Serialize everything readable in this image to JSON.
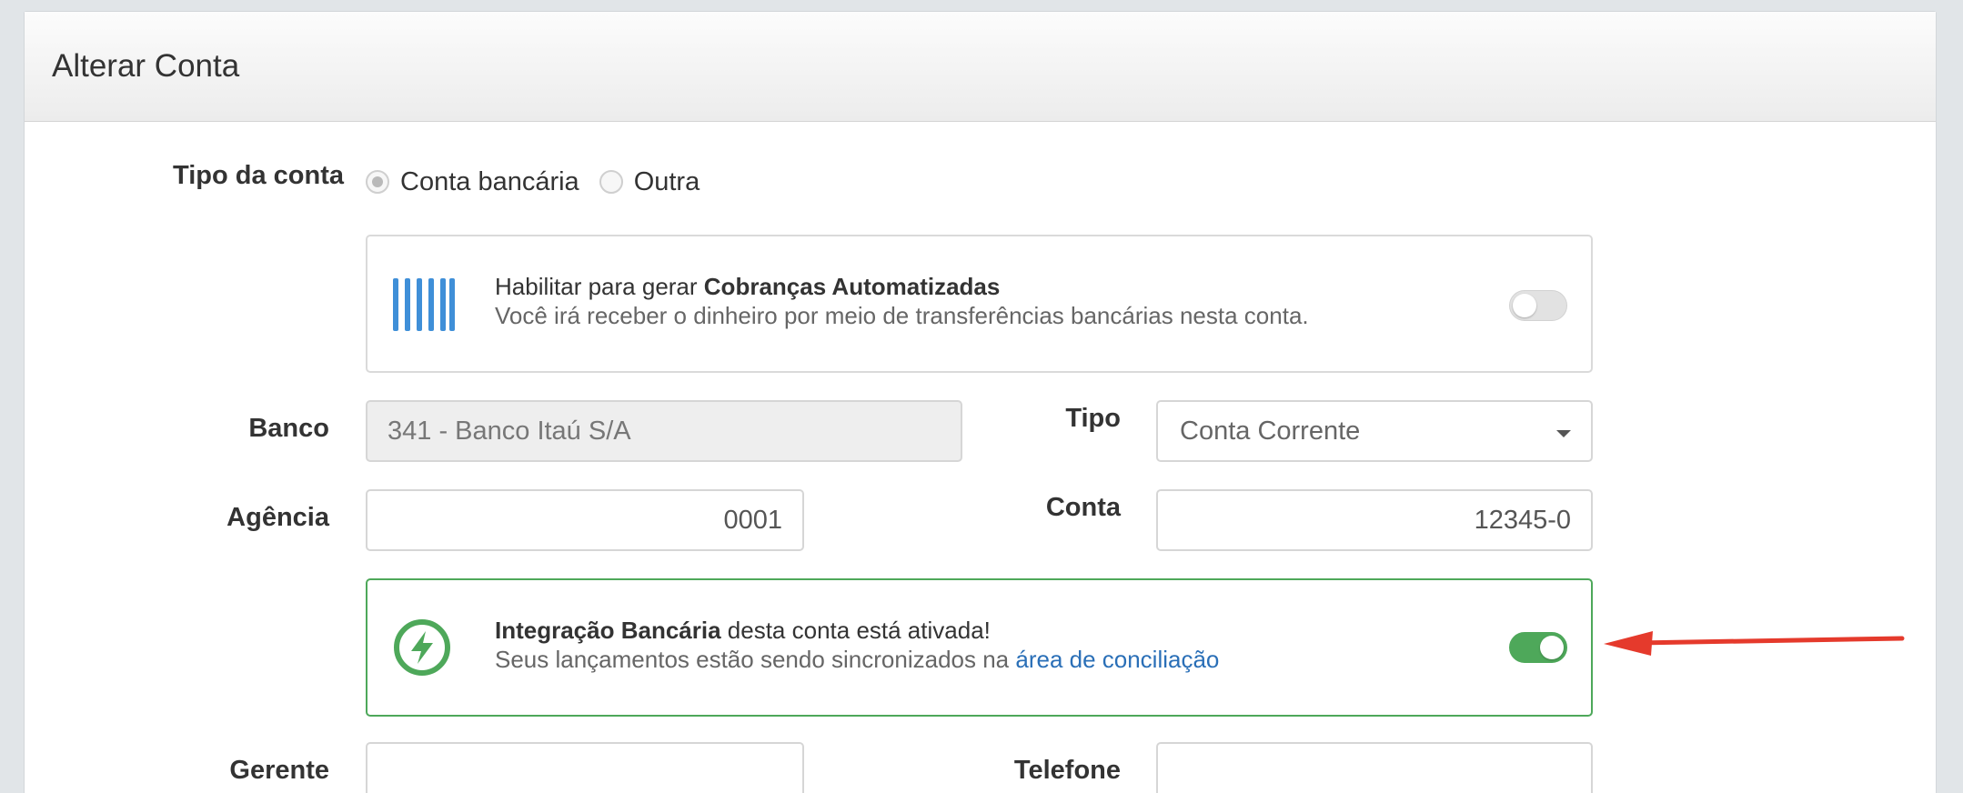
{
  "page": {
    "title": "Alterar Conta"
  },
  "tipo_conta": {
    "label": "Tipo da conta",
    "options": [
      {
        "label": "Conta bancária",
        "checked": true
      },
      {
        "label": "Outra",
        "checked": false
      }
    ]
  },
  "cobrancas_card": {
    "prefix": "Habilitar para gerar ",
    "bold": "Cobranças Automatizadas",
    "subtitle": "Você irá receber o dinheiro por meio de transferências bancárias nesta conta.",
    "enabled": false,
    "icon": "barcode-icon"
  },
  "banco": {
    "label": "Banco",
    "value": "341 - Banco Itaú S/A"
  },
  "tipo": {
    "label": "Tipo",
    "value": "Conta Corrente"
  },
  "agencia": {
    "label": "Agência",
    "value": "0001"
  },
  "conta": {
    "label": "Conta",
    "value": "12345-0"
  },
  "integracao_card": {
    "bold": "Integração Bancária",
    "suffix": " desta conta está ativada!",
    "subtitle_prefix": "Seus lançamentos estão sendo sincronizados na ",
    "link": "área de conciliação",
    "enabled": true,
    "icon": "bolt-icon"
  },
  "gerente": {
    "label": "Gerente",
    "value": ""
  },
  "telefone": {
    "label": "Telefone",
    "value": ""
  },
  "colors": {
    "accent_blue": "#3f8fd8",
    "success_green": "#4ea85a",
    "link": "#2a6fb7",
    "annotation_red": "#e53a2c"
  }
}
